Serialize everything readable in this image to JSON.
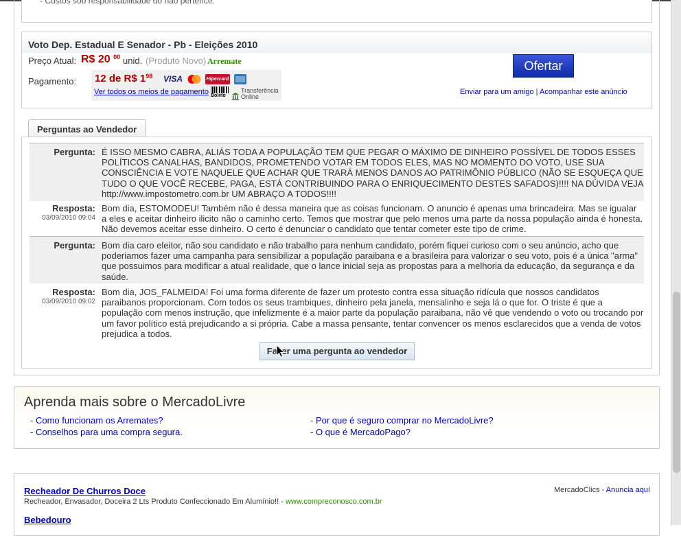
{
  "previous_item": {
    "text": "- Custos sob responsabilidade do não pertence."
  },
  "listing": {
    "title": "Voto Dep. Estadual E Senador - Pb - Eleições 2010",
    "price_label": "Preço Atual:",
    "price_main": "R$ 20",
    "price_cents": "00",
    "price_unit": "unid.",
    "condition": "(Produto Novo)",
    "sale_type": "Arremate",
    "payment_label": "Pagamento:",
    "installments_main": "12 de R$ 1",
    "installments_cents": "98",
    "payment_link": "Ver todos os meios de pagamento",
    "cards": [
      "VISA",
      "MasterCard",
      "Hipercard",
      "AMEX"
    ],
    "boleto_label": "Boleto",
    "transfer_label_1": "Transferência",
    "transfer_label_2": "Online",
    "offer_button": "Ofertar",
    "send_friend_link": "Enviar para um amigo",
    "separator": "|",
    "follow_link": "Acompanhar este anúncio"
  },
  "questions": {
    "tab_label": "Perguntas ao Vendedor",
    "items": [
      {
        "label": "Pergunta:",
        "text": "É ISSO MESMO CABRA, ALIÁS TODA A POPULAÇÃO TEM QUE PEGAR O MÁXIMO DE DINHEIRO POSSÍVEL DE TODOS ESSES POLÍTICOS CANALHAS, BANDIDOS, PROMETENDO VOTAR EM TODOS ELES, MAS NO MOMENTO DO VOTO, USE SUA CONSCIÊNCIA E VOTE NAQUELE QUE ACHAR QUE TRARÁ MENOS DANOS AO PATRIMÔNIO PÚBLICO (NÃO SE ESQUEÇA QUE TUDO O QUE VOCÊ RECEBE, PAGA, ESTÁ CONTRIBUINDO PARA O ENRIQUECIMENTO DESTES SAFADOS)!!!! NA DÚVIDA VEJA http://www.impostometro.com.br UM ABRAÇO A TODOS!!!!"
      },
      {
        "label": "Resposta:",
        "date": "03/09/2010 09:04",
        "text": "Bom dia, ESTOMODEU! Também não é dessa maneira que as coisas funcionam. O anuncio é apenas uma brincadeira. Mas se igualar a eles e aceitar dinheiro ilicito não o caminho certo. Temos que mostrar que pelo menos uma parte da nossa população ainda é honesta. Não devemos aceitar esse dinheiro. O certo é denunciar o candidato que tentar cometer este tipo de crime."
      },
      {
        "label": "Pergunta:",
        "text": "Bom dia caro eleitor, não sou candidato e não trabalho para nenhum candidato, porém fiquei curioso com o seu anúncio, acho que poderiamos fazer uma campanha para sensibilizar a população paraibana e a brasileira para valorizar o seu voto, pois é a única \"arma\" que possuimos para modificar a atual realidade, que o lance inicial seja as propostas para a melhoria da educação, da segurança e da saúde."
      },
      {
        "label": "Resposta:",
        "date": "03/09/2010 09:02",
        "text": "Bom dia, JOS_FALMEIDA! Foi uma forma diferente de fazer um protesto contra essa situação ridícula que nossos candidatos paraibanos proporcionam. Com todos os seus trambiques, dinheiro pela janela, mensalinho e seja lá o que for. O triste é que a população com menos instrução, que infelizmente é a maior parte da população paraibana, não vê que vendendo o voto ou trocando por um favor político está prejudicando a si própria. Cabe a massa pensante, tentar convencer os menos esclarecidos que a venda de votos prejudica a todos."
      }
    ],
    "ask_button": "Fazer uma pergunta ao vendedor"
  },
  "learn_more": {
    "title": "Aprenda mais sobre o MercadoLivre",
    "bullet": "- ",
    "links": [
      "Como funcionam os Arremates?",
      "Conselhos para uma compra segura.",
      "Por que é seguro comprar no MercadoLivre?",
      "O que é MercadoPago?"
    ]
  },
  "ads": {
    "label": "MercadoClics - ",
    "advertise_link": "Anuncia aquí",
    "items": [
      {
        "title": "Recheador De Churros Doce",
        "description": "Recheador, Envasador, Doceira 2 Lts Produto Confeccionado Em Alumínio!! - ",
        "url": "www.compreconosco.com.br"
      },
      {
        "title": "Bebedouro"
      }
    ]
  },
  "colors": {
    "price": "#b30000",
    "sale_type": "#2e8b00",
    "offer_button": "#1a35c0",
    "link": "#0000cc"
  }
}
